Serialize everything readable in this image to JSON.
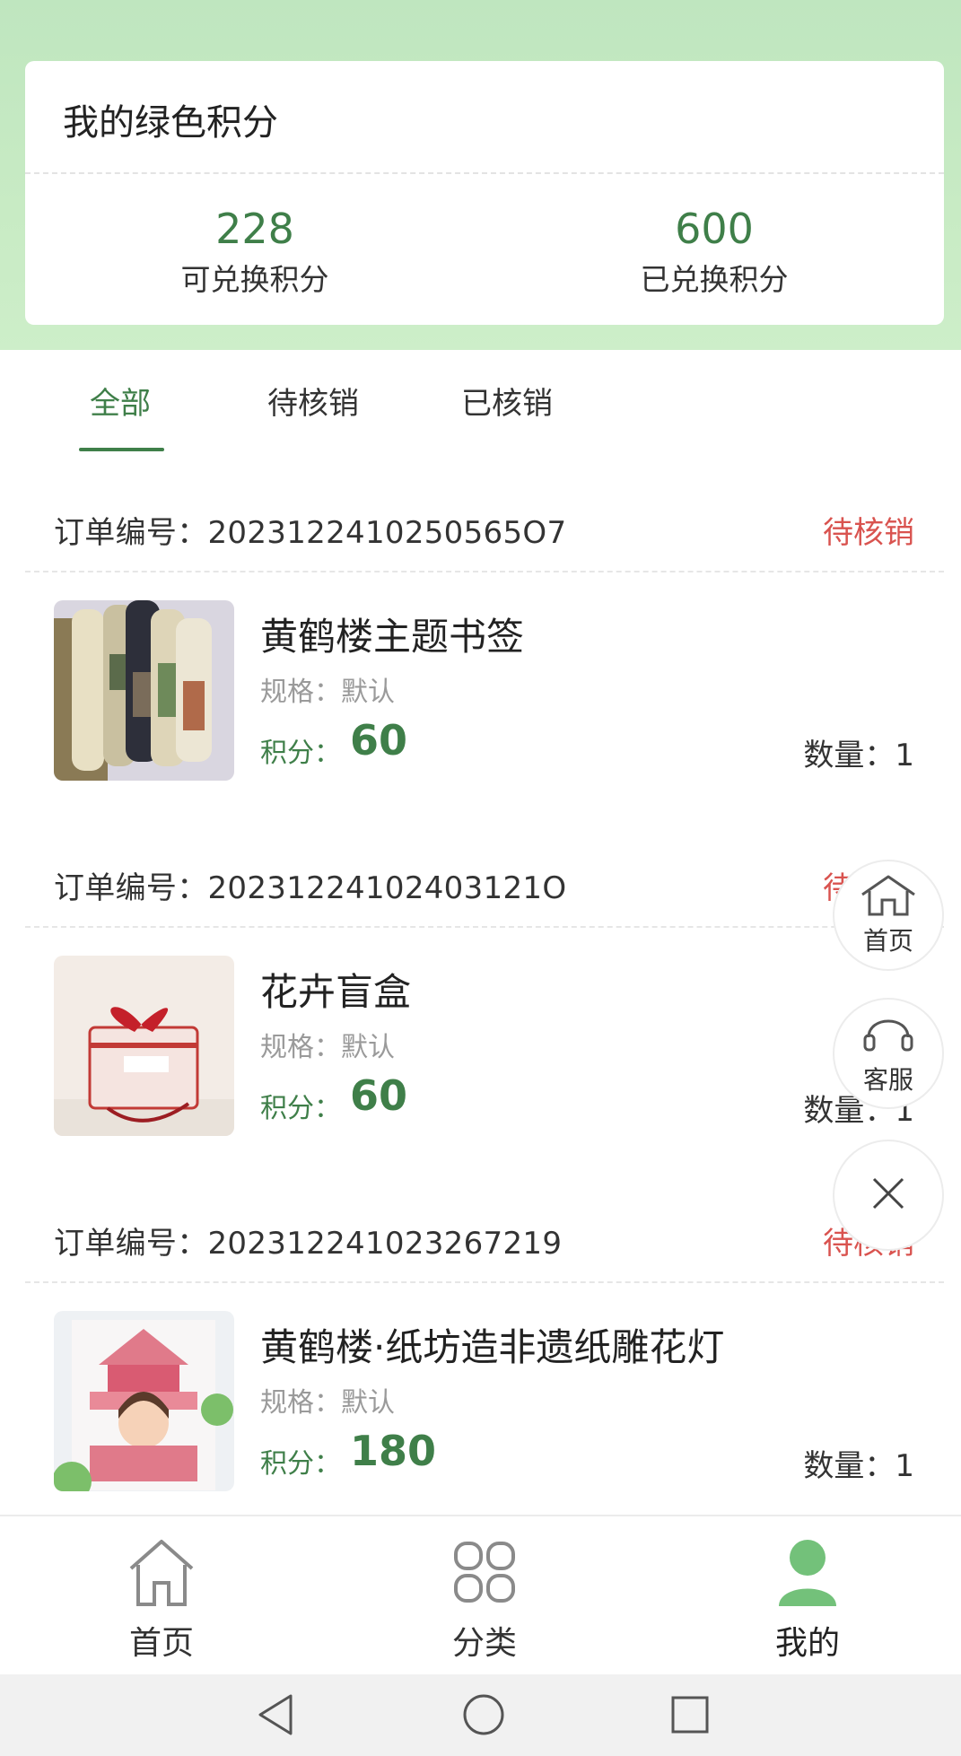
{
  "points_card": {
    "title": "我的绿色积分",
    "available_value": "228",
    "available_label": "可兑换积分",
    "exchanged_value": "600",
    "exchanged_label": "已兑换积分"
  },
  "tabs": [
    {
      "label": "全部",
      "active": true
    },
    {
      "label": "待核销",
      "active": false
    },
    {
      "label": "已核销",
      "active": false
    }
  ],
  "orders": [
    {
      "order_no": "订单编号：2023122410250565O7",
      "status": "待核销",
      "name": "黄鹤楼主题书签",
      "spec": "规格：默认",
      "points_label": "积分：",
      "points": "60",
      "qty": "数量：1"
    },
    {
      "order_no": "订单编号：20231224102403121O",
      "status": "待核销",
      "name": "花卉盲盒",
      "spec": "规格：默认",
      "points_label": "积分：",
      "points": "60",
      "qty": "数量：1"
    },
    {
      "order_no": "订单编号：20231224102326721​9",
      "status": "待核销",
      "name": "黄鹤楼·纸坊造非遗纸雕花灯",
      "spec": "规格：默认",
      "points_label": "积分：",
      "points": "180",
      "qty": "数量：1"
    }
  ],
  "float_menu": {
    "home_label": "首页",
    "service_label": "客服"
  },
  "bottom_nav": [
    {
      "label": "首页",
      "icon": "home-icon",
      "active": false
    },
    {
      "label": "分类",
      "icon": "grid-icon",
      "active": false
    },
    {
      "label": "我的",
      "icon": "user-icon",
      "active": true
    }
  ],
  "colors": {
    "accent_green": "#3f7f49",
    "status_red": "#d9534f",
    "header_bg": "#c8ebc4"
  }
}
